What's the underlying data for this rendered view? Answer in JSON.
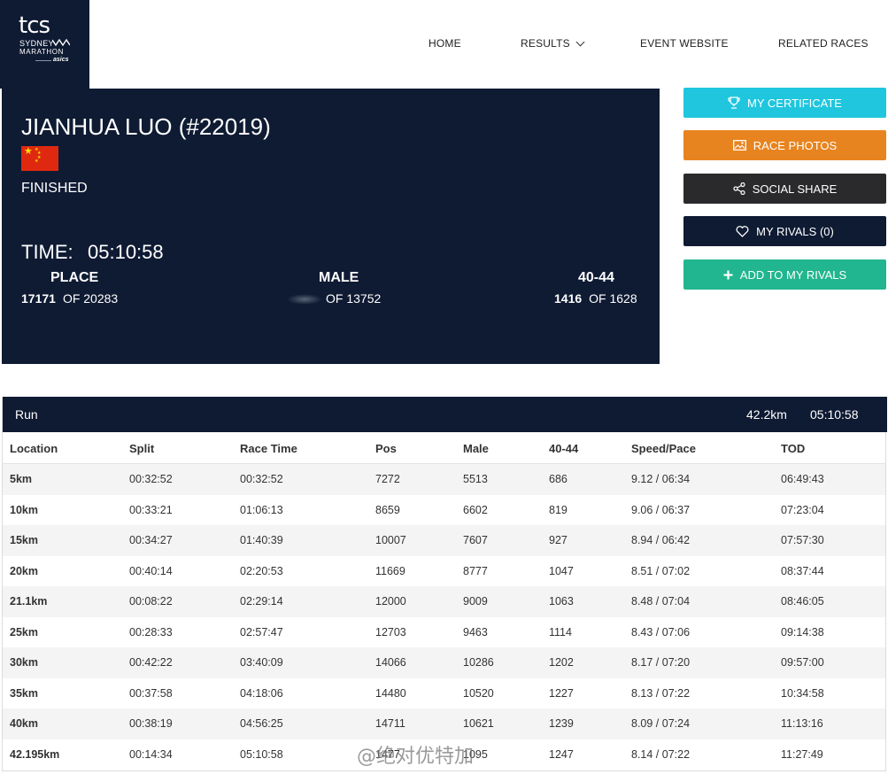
{
  "logo": {
    "line1": "tcs",
    "line2": "SYDNEY",
    "line3": "MARATHON",
    "line4": "asics"
  },
  "nav": {
    "home": "HOME",
    "results": "RESULTS",
    "event_website": "EVENT WEBSITE",
    "related_races": "RELATED RACES"
  },
  "athlete": {
    "name": "JIANHUA LUO (#22019)",
    "status": "FINISHED",
    "time_label": "TIME:",
    "time": "05:10:58",
    "place": {
      "label": "PLACE",
      "rank": "17171",
      "of": "OF 20283"
    },
    "gender": {
      "label": "MALE",
      "rank": "",
      "of": "OF 13752"
    },
    "age_group": {
      "label": "40-44",
      "rank": "1416",
      "of": "OF 1628"
    }
  },
  "actions": {
    "certificate": "MY CERTIFICATE",
    "photos": "RACE PHOTOS",
    "share": "SOCIAL SHARE",
    "rivals": "MY RIVALS (0)",
    "add_rivals": "ADD TO MY RIVALS"
  },
  "colors": {
    "navy": "#0f1b33",
    "cyan": "#1fc6de",
    "orange": "#e8841f",
    "charcoal": "#2a2a2c",
    "green": "#21b68f"
  },
  "run": {
    "title": "Run",
    "distance": "42.2km",
    "time": "05:10:58"
  },
  "splits": {
    "headers": [
      "Location",
      "Split",
      "Race Time",
      "Pos",
      "Male",
      "40-44",
      "Speed/Pace",
      "TOD"
    ],
    "rows": [
      [
        "5km",
        "00:32:52",
        "00:32:52",
        "7272",
        "5513",
        "686",
        "9.12 / 06:34",
        "06:49:43"
      ],
      [
        "10km",
        "00:33:21",
        "01:06:13",
        "8659",
        "6602",
        "819",
        "9.06 / 06:37",
        "07:23:04"
      ],
      [
        "15km",
        "00:34:27",
        "01:40:39",
        "10007",
        "7607",
        "927",
        "8.94 / 06:42",
        "07:57:30"
      ],
      [
        "20km",
        "00:40:14",
        "02:20:53",
        "11669",
        "8777",
        "1047",
        "8.51 / 07:02",
        "08:37:44"
      ],
      [
        "21.1km",
        "00:08:22",
        "02:29:14",
        "12000",
        "9009",
        "1063",
        "8.48 / 07:04",
        "08:46:05"
      ],
      [
        "25km",
        "00:28:33",
        "02:57:47",
        "12703",
        "9463",
        "1114",
        "8.43 / 07:06",
        "09:14:38"
      ],
      [
        "30km",
        "00:42:22",
        "03:40:09",
        "14066",
        "10286",
        "1202",
        "8.17 / 07:20",
        "09:57:00"
      ],
      [
        "35km",
        "00:37:58",
        "04:18:06",
        "14480",
        "10520",
        "1227",
        "8.13 / 07:22",
        "10:34:58"
      ],
      [
        "40km",
        "00:38:19",
        "04:56:25",
        "14711",
        "10621",
        "1239",
        "8.09 / 07:24",
        "11:13:16"
      ],
      [
        "42.195km",
        "00:14:34",
        "05:10:58",
        "1477",
        "1095",
        "1247",
        "8.14 / 07:22",
        "11:27:49"
      ]
    ]
  },
  "watermark": "@绝对优特加"
}
